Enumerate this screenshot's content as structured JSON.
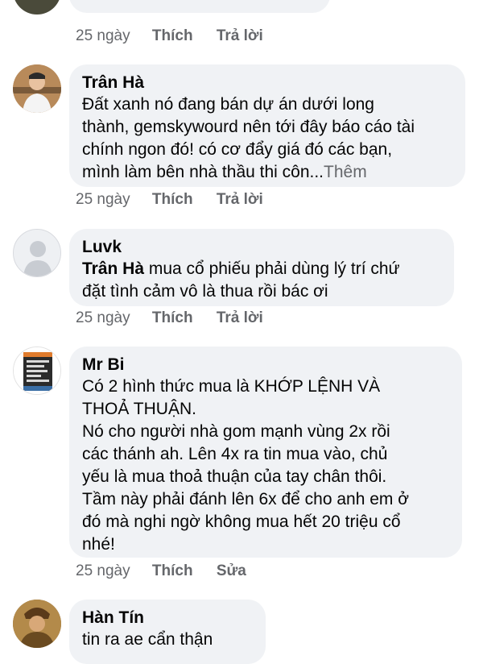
{
  "comments": [
    {
      "actions": {
        "age": "25 ngày",
        "like": "Thích",
        "reply": "Trả lời"
      }
    },
    {
      "author": "Trân Hà",
      "lines": [
        "Đất xanh nó đang bán dự án dưới long",
        "thành, gemskywourd nên tới đây báo cáo tài",
        "chính ngon đó! có cơ đẩy giá đó các bạn,",
        "mình làm bên nhà thầu thi côn..."
      ],
      "more": "Thêm",
      "actions": {
        "age": "25 ngày",
        "like": "Thích",
        "reply": "Trả lời"
      }
    },
    {
      "author": "Luvk",
      "tag": "Trân Hà",
      "lines": [
        " mua cổ phiếu phải dùng lý trí chứ",
        "đặt tình cảm vô là thua rồi bác ơi"
      ],
      "actions": {
        "age": "25 ngày",
        "like": "Thích",
        "reply": "Trả lời"
      }
    },
    {
      "author": "Mr Bi",
      "lines": [
        "Có 2 hình thức mua là KHỚP LỆNH VÀ",
        "THOẢ THUẬN.",
        "Nó cho người nhà gom mạnh vùng 2x rồi",
        "các thánh ah. Lên 4x ra tin mua vào, chủ",
        "yếu là mua thoả thuận của tay chân thôi.",
        "Tầm này phải đánh lên 6x để cho anh em ở",
        "đó mà nghi ngờ không mua hết 20 triệu cổ",
        "nhé!"
      ],
      "actions": {
        "age": "25 ngày",
        "like": "Thích",
        "edit": "Sửa"
      }
    },
    {
      "author": "Hàn Tín",
      "lines": [
        "tin ra ae cẩn thận"
      ]
    }
  ],
  "colors": {
    "bubble": "#f0f2f5",
    "meta": "#65676b",
    "text": "#050505"
  }
}
